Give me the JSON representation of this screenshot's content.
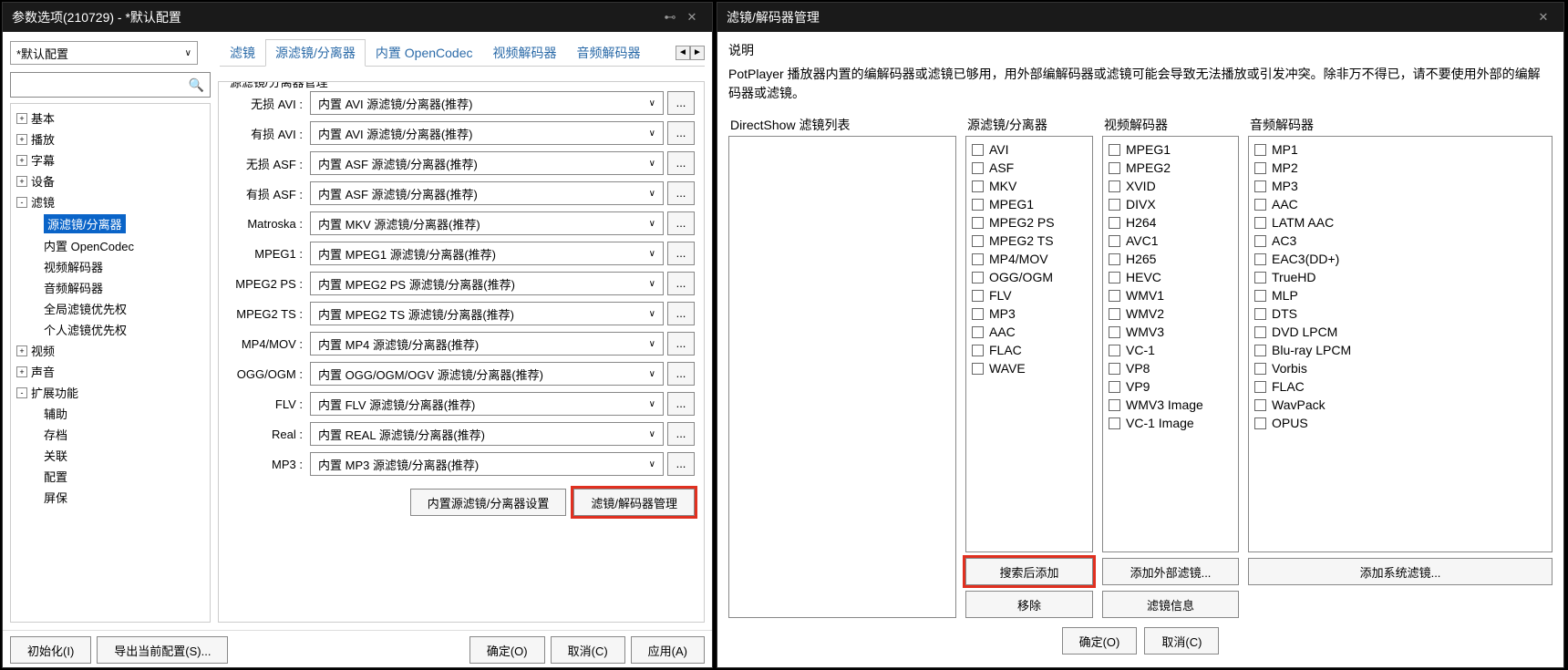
{
  "left": {
    "title": "参数选项(210729) - *默认配置",
    "config_label": "*默认配置",
    "tabs": [
      "滤镜",
      "源滤镜/分离器",
      "内置 OpenCodec",
      "视频解码器",
      "音频解码器"
    ],
    "active_tab": 1,
    "tree": [
      {
        "label": "基本",
        "toggle": "+"
      },
      {
        "label": "播放",
        "toggle": "+"
      },
      {
        "label": "字幕",
        "toggle": "+"
      },
      {
        "label": "设备",
        "toggle": "+"
      },
      {
        "label": "滤镜",
        "toggle": "-",
        "children": [
          {
            "label": "源滤镜/分离器",
            "selected": true
          },
          {
            "label": "内置 OpenCodec"
          },
          {
            "label": "视频解码器"
          },
          {
            "label": "音频解码器"
          },
          {
            "label": "全局滤镜优先权"
          },
          {
            "label": "个人滤镜优先权"
          }
        ]
      },
      {
        "label": "视频",
        "toggle": "+"
      },
      {
        "label": "声音",
        "toggle": "+"
      },
      {
        "label": "扩展功能",
        "toggle": "-",
        "children": [
          {
            "label": "辅助"
          },
          {
            "label": "存档"
          },
          {
            "label": "关联"
          },
          {
            "label": "配置"
          },
          {
            "label": "屏保"
          }
        ]
      }
    ],
    "group_title": "源滤镜/分离器管理",
    "rows": [
      {
        "label": "无损 AVI :",
        "value": "内置 AVI 源滤镜/分离器(推荐)"
      },
      {
        "label": "有损 AVI :",
        "value": "内置 AVI 源滤镜/分离器(推荐)"
      },
      {
        "label": "无损 ASF :",
        "value": "内置 ASF 源滤镜/分离器(推荐)"
      },
      {
        "label": "有损 ASF :",
        "value": "内置 ASF 源滤镜/分离器(推荐)"
      },
      {
        "label": "Matroska :",
        "value": "内置 MKV 源滤镜/分离器(推荐)"
      },
      {
        "label": "MPEG1 :",
        "value": "内置 MPEG1 源滤镜/分离器(推荐)"
      },
      {
        "label": "MPEG2 PS :",
        "value": "内置 MPEG2 PS 源滤镜/分离器(推荐)"
      },
      {
        "label": "MPEG2 TS :",
        "value": "内置 MPEG2 TS 源滤镜/分离器(推荐)"
      },
      {
        "label": "MP4/MOV :",
        "value": "内置 MP4 源滤镜/分离器(推荐)"
      },
      {
        "label": "OGG/OGM :",
        "value": "内置 OGG/OGM/OGV 源滤镜/分离器(推荐)"
      },
      {
        "label": "FLV :",
        "value": "内置 FLV 源滤镜/分离器(推荐)"
      },
      {
        "label": "Real :",
        "value": "内置 REAL 源滤镜/分离器(推荐)"
      },
      {
        "label": "MP3 :",
        "value": "内置 MP3 源滤镜/分离器(推荐)"
      }
    ],
    "bottom_btn1": "内置源滤镜/分离器设置",
    "bottom_btn2": "滤镜/解码器管理",
    "footer": {
      "init": "初始化(I)",
      "export": "导出当前配置(S)...",
      "ok": "确定(O)",
      "cancel": "取消(C)",
      "apply": "应用(A)"
    }
  },
  "right": {
    "title": "滤镜/解码器管理",
    "desc_title": "说明",
    "desc_text": "PotPlayer 播放器内置的编解码器或滤镜已够用，用外部编解码器或滤镜可能会导致无法播放或引发冲突。除非万不得已，请不要使用外部的编解码器或滤镜。",
    "col1_title": "DirectShow 滤镜列表",
    "col2_title": "源滤镜/分离器",
    "col2_items": [
      "AVI",
      "ASF",
      "MKV",
      "MPEG1",
      "MPEG2 PS",
      "MPEG2 TS",
      "MP4/MOV",
      "OGG/OGM",
      "FLV",
      "MP3",
      "AAC",
      "FLAC",
      "WAVE"
    ],
    "col3_title": "视频解码器",
    "col3_items": [
      "MPEG1",
      "MPEG2",
      "XVID",
      "DIVX",
      "H264",
      "AVC1",
      "H265",
      "HEVC",
      "WMV1",
      "WMV2",
      "WMV3",
      "VC-1",
      "VP8",
      "VP9",
      "WMV3 Image",
      "VC-1 Image"
    ],
    "col4_title": "音频解码器",
    "col4_items": [
      "MP1",
      "MP2",
      "MP3",
      "AAC",
      "LATM AAC",
      "AC3",
      "EAC3(DD+)",
      "TrueHD",
      "MLP",
      "DTS",
      "DVD LPCM",
      "Blu-ray LPCM",
      "Vorbis",
      "FLAC",
      "WavPack",
      "OPUS"
    ],
    "btn_search": "搜索后添加",
    "btn_add_ext": "添加外部滤镜...",
    "btn_add_sys": "添加系统滤镜...",
    "btn_remove": "移除",
    "btn_info": "滤镜信息",
    "btn_ok": "确定(O)",
    "btn_cancel": "取消(C)"
  }
}
